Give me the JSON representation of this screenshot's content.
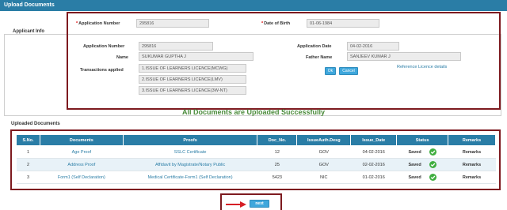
{
  "header": {
    "title": "Upload Documents"
  },
  "search": {
    "application_number_label": "Application Number",
    "application_number_value": "295816",
    "dob_label": "Date of Birth",
    "dob_value": "01-06-1984"
  },
  "applicant_info": {
    "legend": "Applicant Info",
    "application_number_label": "Application Number",
    "application_number_value": "295816",
    "name_label": "Name",
    "name_value": "SUKUMAR GUPTHA J",
    "transactions_label": "Transactions applied",
    "transactions": [
      "1.ISSUE OF LEARNERS LICENCE(MCWG)",
      "2.ISSUE OF LEARNERS LICENCE(LMV)",
      "3.ISSUE OF LEARNERS LICENCE(3W-NT)"
    ],
    "application_date_label": "Application Date",
    "application_date_value": "04-02-2016",
    "father_name_label": "Father Name",
    "father_name_value": "SANJEEV KUMAR J",
    "ok_label": "Ok",
    "cancel_label": "Cancel",
    "reference_link": "Reference Licence details"
  },
  "success_message": "All Documents are Uploaded Successfully",
  "uploaded_documents": {
    "label": "Uploaded Documents",
    "columns": [
      "S.No.",
      "Documents",
      "Proofs",
      "Doc_No.",
      "IssueAuth.Desg",
      "Issue_Date",
      "Status",
      "Remarks"
    ],
    "rows": [
      {
        "sno": "1",
        "document": "Age Proof",
        "proof": "SSLC Certificate",
        "doc_no": "12",
        "issue_auth": "GOV",
        "issue_date": "04-02-2016",
        "status": "Saved",
        "remarks": "Remarks"
      },
      {
        "sno": "2",
        "document": "Address Proof",
        "proof": "Affidavit by Magistrate/Notary Public",
        "doc_no": "25",
        "issue_auth": "GOV",
        "issue_date": "02-02-2016",
        "status": "Saved",
        "remarks": "Remarks"
      },
      {
        "sno": "3",
        "document": "Form1 (Self Declaration)",
        "proof": "Medical Certificate-Form1 (Self Declaration)",
        "doc_no": "5423",
        "issue_auth": "NIC",
        "issue_date": "01-02-2016",
        "status": "Saved",
        "remarks": "Remarks"
      }
    ]
  },
  "next_label": "next",
  "colors": {
    "header_blue": "#2a7da6",
    "button_blue": "#3fa7dc",
    "highlight_red": "#7d1a1f",
    "success_green": "#4a8a3a",
    "tick_green": "#3fae3f"
  },
  "icons": {
    "status": "check-circle-icon",
    "arrow": "arrow-right-icon"
  }
}
